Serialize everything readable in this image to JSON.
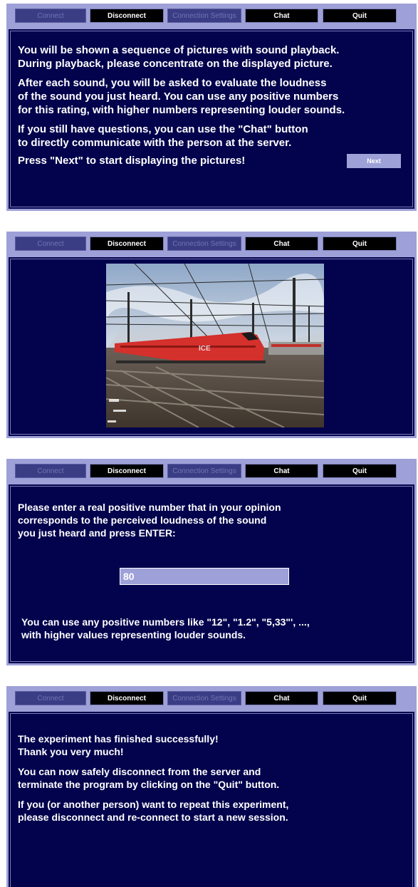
{
  "toolbar": {
    "connect": "Connect",
    "disconnect": "Disconnect",
    "connection_settings": "Connection Settings",
    "chat": "Chat",
    "quit": "Quit"
  },
  "screen1": {
    "para1": "You will be shown a sequence of pictures with sound playback.\nDuring playback, please concentrate on the displayed picture.",
    "para2": "After each sound, you will be asked to evaluate the loudness\nof the sound you just heard. You can use any positive numbers\nfor this rating, with higher numbers representing louder sounds.",
    "para3": "If you still have questions, you can use the \"Chat\" button\nto directly communicate with the person at the server.",
    "para4": "Press \"Next\" to start displaying the pictures!",
    "next_label": "Next"
  },
  "screen2": {
    "train_logo": "ICE"
  },
  "screen3": {
    "prompt": "Please enter a real positive number that in your opinion\ncorresponds to the perceived loudness of the sound\nyou just heard and press ENTER:",
    "input_value": "80",
    "hint": "You can use any positive numbers like \"12\", \"1.2\", \"5,33\"', ...,\nwith higher values representing louder sounds."
  },
  "screen4": {
    "para1": "The experiment has finished successfully!\nThank you very much!",
    "para2": "You can now safely disconnect from the server and\nterminate the program by clicking on the \"Quit\" button.",
    "para3": "If you (or another person) want to repeat this experiment,\nplease disconnect and re-connect to start a new session."
  }
}
